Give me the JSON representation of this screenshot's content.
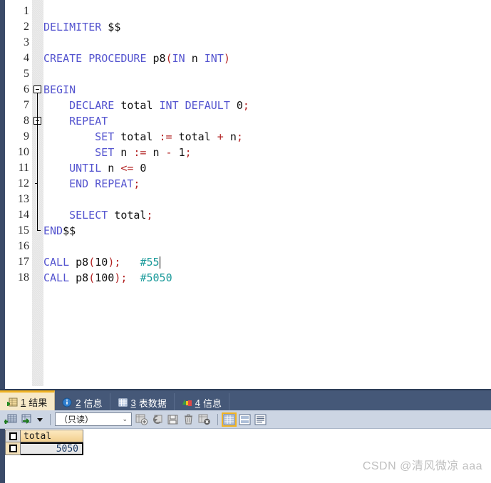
{
  "editor": {
    "lines": [
      {
        "n": "1",
        "tokens": []
      },
      {
        "n": "2",
        "tokens": [
          {
            "t": "kw",
            "v": "DELIMITER"
          },
          {
            "t": "id",
            "v": " $$"
          }
        ],
        "indent": 0
      },
      {
        "n": "3",
        "tokens": []
      },
      {
        "n": "4",
        "tokens": [
          {
            "t": "kw",
            "v": "CREATE PROCEDURE "
          },
          {
            "t": "id",
            "v": "p8"
          },
          {
            "t": "op",
            "v": "("
          },
          {
            "t": "kw",
            "v": "IN "
          },
          {
            "t": "id",
            "v": "n "
          },
          {
            "t": "kw",
            "v": "INT"
          },
          {
            "t": "op",
            "v": ")"
          }
        ],
        "indent": 0
      },
      {
        "n": "5",
        "tokens": []
      },
      {
        "n": "6",
        "tokens": [
          {
            "t": "kw",
            "v": "BEGIN"
          }
        ],
        "indent": -1
      },
      {
        "n": "7",
        "tokens": [
          {
            "t": "kw",
            "v": "DECLARE "
          },
          {
            "t": "id",
            "v": "total "
          },
          {
            "t": "kw",
            "v": "INT DEFAULT "
          },
          {
            "t": "num",
            "v": "0"
          },
          {
            "t": "op",
            "v": ";"
          }
        ],
        "indent": 2
      },
      {
        "n": "8",
        "tokens": [
          {
            "t": "kw",
            "v": "REPEAT"
          }
        ],
        "indent": 2
      },
      {
        "n": "9",
        "tokens": [
          {
            "t": "kw",
            "v": "SET "
          },
          {
            "t": "id",
            "v": "total "
          },
          {
            "t": "op",
            "v": ":= "
          },
          {
            "t": "id",
            "v": "total "
          },
          {
            "t": "op",
            "v": "+ "
          },
          {
            "t": "id",
            "v": "n"
          },
          {
            "t": "op",
            "v": ";"
          }
        ],
        "indent": 4
      },
      {
        "n": "10",
        "tokens": [
          {
            "t": "kw",
            "v": "SET "
          },
          {
            "t": "id",
            "v": "n "
          },
          {
            "t": "op",
            "v": ":= "
          },
          {
            "t": "id",
            "v": "n "
          },
          {
            "t": "op",
            "v": "- "
          },
          {
            "t": "num",
            "v": "1"
          },
          {
            "t": "op",
            "v": ";"
          }
        ],
        "indent": 4
      },
      {
        "n": "11",
        "tokens": [
          {
            "t": "kw",
            "v": "UNTIL "
          },
          {
            "t": "id",
            "v": "n "
          },
          {
            "t": "op",
            "v": "<= "
          },
          {
            "t": "num",
            "v": "0"
          }
        ],
        "indent": 2
      },
      {
        "n": "12",
        "tokens": [
          {
            "t": "kw",
            "v": "END REPEAT"
          },
          {
            "t": "op",
            "v": ";"
          }
        ],
        "indent": 2
      },
      {
        "n": "13",
        "tokens": []
      },
      {
        "n": "14",
        "tokens": [
          {
            "t": "kw",
            "v": "SELECT "
          },
          {
            "t": "id",
            "v": "total"
          },
          {
            "t": "op",
            "v": ";"
          }
        ],
        "indent": 2
      },
      {
        "n": "15",
        "tokens": [
          {
            "t": "kw",
            "v": "END"
          },
          {
            "t": "id",
            "v": "$$"
          }
        ],
        "indent": -1
      },
      {
        "n": "16",
        "tokens": []
      },
      {
        "n": "17",
        "tokens": [
          {
            "t": "kw",
            "v": "CALL "
          },
          {
            "t": "id",
            "v": "p8"
          },
          {
            "t": "op",
            "v": "("
          },
          {
            "t": "num",
            "v": "10"
          },
          {
            "t": "op",
            "v": ");"
          },
          {
            "t": "id",
            "v": "   "
          },
          {
            "t": "cm",
            "v": "#55"
          }
        ],
        "indent": 0
      },
      {
        "n": "18",
        "tokens": [
          {
            "t": "kw",
            "v": "CALL "
          },
          {
            "t": "id",
            "v": "p8"
          },
          {
            "t": "op",
            "v": "("
          },
          {
            "t": "num",
            "v": "100"
          },
          {
            "t": "op",
            "v": ");"
          },
          {
            "t": "id",
            "v": "  "
          },
          {
            "t": "cm",
            "v": "#5050"
          }
        ],
        "indent": 0
      }
    ],
    "caret_line": "17",
    "colors": {
      "keyword": "#5454cf",
      "identifier": "#111111",
      "operator": "#b22222",
      "comment": "#1a9a9a",
      "background": "#ffffff",
      "edge_strip": "#3a4a68"
    }
  },
  "panel": {
    "tabs": [
      {
        "num": "1",
        "label": "结果",
        "icon": "result-grid-icon",
        "active": true
      },
      {
        "num": "2",
        "label": "信息",
        "icon": "info-icon",
        "active": false
      },
      {
        "num": "3",
        "label": "表数据",
        "icon": "table-data-icon",
        "active": false
      },
      {
        "num": "4",
        "label": "信息",
        "icon": "profile-info-icon",
        "active": false
      }
    ],
    "toolbar": {
      "buttons": [
        {
          "name": "new-grid-button",
          "icon": "grid-plus-icon"
        },
        {
          "name": "export-button",
          "icon": "grid-export-icon"
        },
        {
          "name": "dropdown-button",
          "icon": "caret-down-icon"
        }
      ],
      "mode_select": {
        "value": "（只读）",
        "chevron": "⌄"
      },
      "record_buttons": [
        {
          "name": "add-record-button",
          "icon": "record-add-icon"
        },
        {
          "name": "refresh-button",
          "icon": "refresh-icon"
        },
        {
          "name": "save-record-button",
          "icon": "save-icon"
        },
        {
          "name": "delete-record-button",
          "icon": "trash-icon"
        },
        {
          "name": "cancel-edit-button",
          "icon": "record-cancel-icon"
        }
      ],
      "view_buttons": [
        {
          "name": "grid-view-button",
          "icon": "grid-view-icon",
          "selected": true
        },
        {
          "name": "form-view-button",
          "icon": "form-view-icon",
          "selected": false
        },
        {
          "name": "text-view-button",
          "icon": "text-view-icon",
          "selected": false
        }
      ]
    },
    "result_grid": {
      "columns": [
        "total"
      ],
      "rows": [
        [
          "5050"
        ]
      ]
    },
    "watermark": "CSDN @清风微凉 aaa",
    "colors": {
      "tabbar_bg": "#455878",
      "active_tab_bg": "#f7e9c8",
      "accent": "#f0b323",
      "toolbar_bg": "#ccd5e3"
    }
  }
}
